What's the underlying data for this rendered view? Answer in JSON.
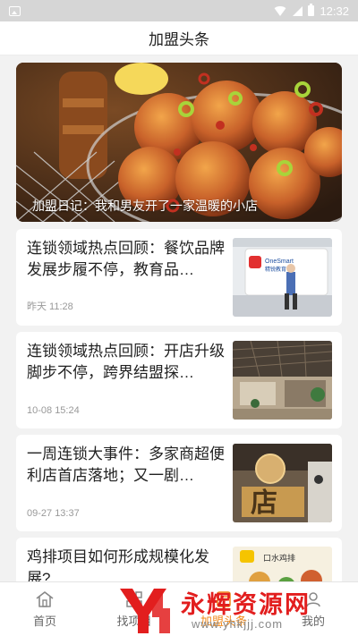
{
  "status_bar": {
    "time": "12:32"
  },
  "header": {
    "title": "加盟头条"
  },
  "banner": {
    "caption": "加盟日记：我和男友开了一家温暖的小店"
  },
  "articles": [
    {
      "title": "连锁领域热点回顾：餐饮品牌发展步履不停，教育品…",
      "time": "昨天 11:28",
      "thumb_text": "OneSmart",
      "thumb_subtext": "精锐教育"
    },
    {
      "title": "连锁领域热点回顾：开店升级脚步不停，跨界结盟探…",
      "time": "10-08 15:24"
    },
    {
      "title": "一周连锁大事件：多家商超便利店首店落地；又一剧…",
      "time": "09-27 13:37",
      "thumb_text": "店"
    },
    {
      "title": "鸡排项目如何形成规模化发展?",
      "time": "",
      "thumb_text": "口水鸡排"
    }
  ],
  "tabbar": {
    "items": [
      {
        "label": "首页",
        "icon": "home-icon"
      },
      {
        "label": "找项目",
        "icon": "grid-icon"
      },
      {
        "label": "加盟头条",
        "icon": "news-icon"
      },
      {
        "label": "我的",
        "icon": "user-icon"
      }
    ],
    "active": "加盟头条",
    "active_color": "#f08a1c"
  },
  "watermark": {
    "text": "永辉资源网",
    "url": "www.yhkjjj.com",
    "color": "#e21e1e"
  }
}
